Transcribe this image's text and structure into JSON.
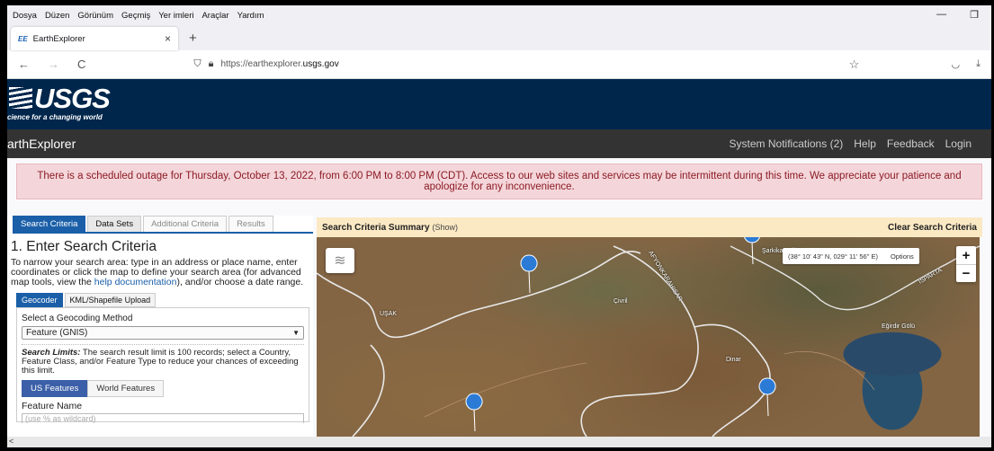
{
  "menu": [
    "Dosya",
    "Düzen",
    "Görünüm",
    "Geçmiş",
    "Yer imleri",
    "Araçlar",
    "Yardım"
  ],
  "window_controls": {
    "minimize": "—",
    "restore": "❐"
  },
  "tab": {
    "favicon": "EE",
    "title": "EarthExplorer",
    "close": "×",
    "new_tab": "+"
  },
  "nav": {
    "back": "←",
    "forward": "→",
    "reload": "C",
    "url_prefix": "https://earthexplorer.",
    "url_domain": "usgs.gov"
  },
  "usgs": {
    "logo": "USGS",
    "tagline": "cience for a changing world"
  },
  "ee": {
    "brand": "arthExplorer",
    "links": [
      "System Notifications (2)",
      "Help",
      "Feedback",
      "Login"
    ]
  },
  "alert": "There is a scheduled outage for Thursday, October 13, 2022, from 6:00 PM to 8:00 PM (CDT). Access to our web sites and services may be intermittent during this time. We appreciate your patience and apologize for any inconvenience.",
  "panel": {
    "tabs": [
      "Search Criteria",
      "Data Sets",
      "Additional Criteria",
      "Results"
    ],
    "heading": "1. Enter Search Criteria",
    "desc_before": "To narrow your search area: type in an address or place name, enter coordinates or click the map to define your search area (for advanced map tools, view the ",
    "desc_link": "help documentation",
    "desc_after": "), and/or choose a date range.",
    "subtabs": [
      "Geocoder",
      "KML/Shapefile Upload"
    ],
    "method_label": "Select a Geocoding Method",
    "method_value": "Feature (GNIS)",
    "limits_bold": "Search Limits:",
    "limits_text": " The search result limit is 100 records; select a Country, Feature Class, and/or Feature Type to reduce your chances of exceeding this limit.",
    "feature_tabs": [
      "US Features",
      "World Features"
    ],
    "feature_name_label": "Feature Name",
    "feature_name_placeholder": "(use % as wildcard)"
  },
  "summary": {
    "title": "Search Criteria Summary",
    "show": "(Show)",
    "clear": "Clear Search Criteria"
  },
  "map": {
    "coords": "(38° 10' 43\" N, 029° 11' 56\" E)",
    "options": "Options",
    "zoom_in": "+",
    "zoom_out": "−",
    "labels": [
      "AFYONKARAHISAR",
      "UŞAK",
      "Çivril",
      "Dinar",
      "Eğirdir Gölü",
      "ISPARTA",
      "Şarkikaraağaç"
    ]
  },
  "colors": {
    "usgs_blue": "#00264c",
    "accent": "#1a5fa8",
    "alert_bg": "#f4d6da",
    "summary_bg": "#fbe9c4",
    "pin": "#2b7bd6"
  }
}
